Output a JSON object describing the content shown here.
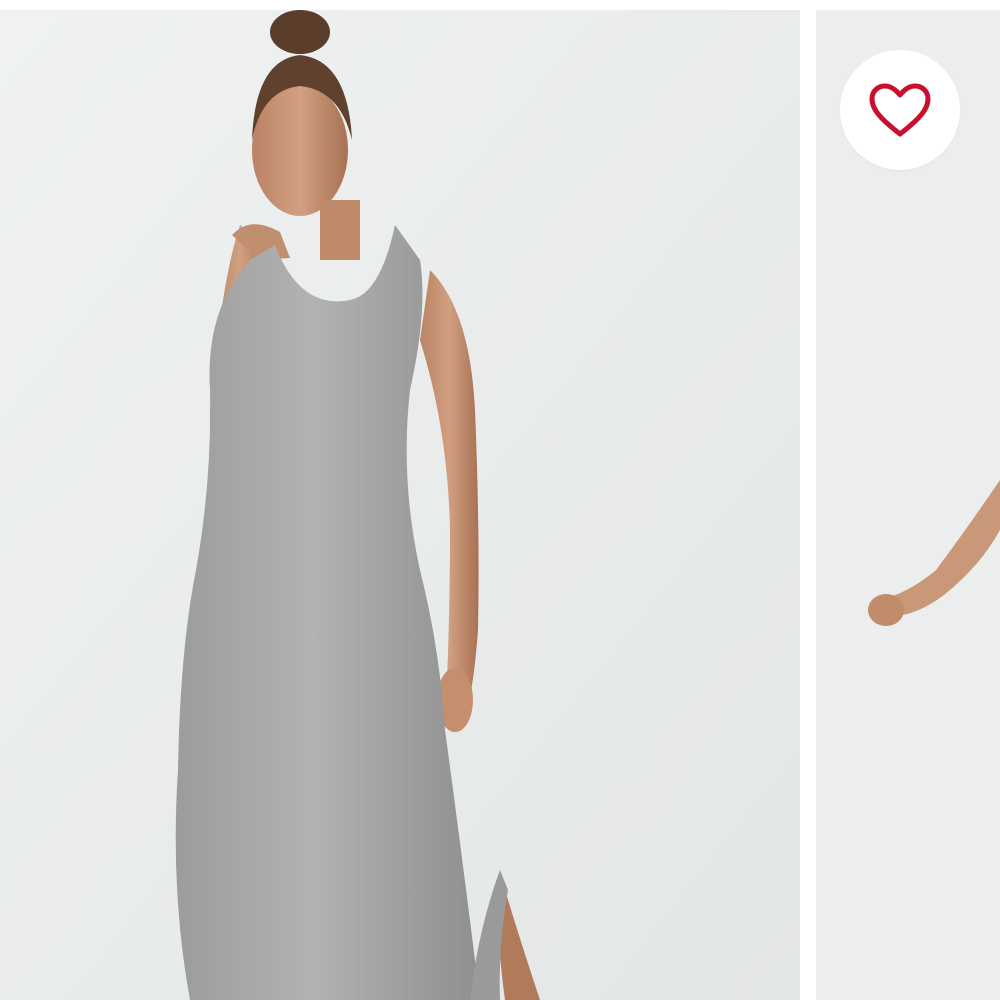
{
  "carousel": {
    "slides": [
      {
        "image": "model-grey-racerback-maxi-dress-front",
        "background": "#e9ecec",
        "dress_color": "#a6a6a6"
      },
      {
        "image": "model-grey-racerback-maxi-dress-side",
        "background": "#e9ecec"
      }
    ]
  },
  "favorite_button": {
    "icon": "heart-outline-icon",
    "icon_color": "#c8102e",
    "state": "not-favorited"
  }
}
